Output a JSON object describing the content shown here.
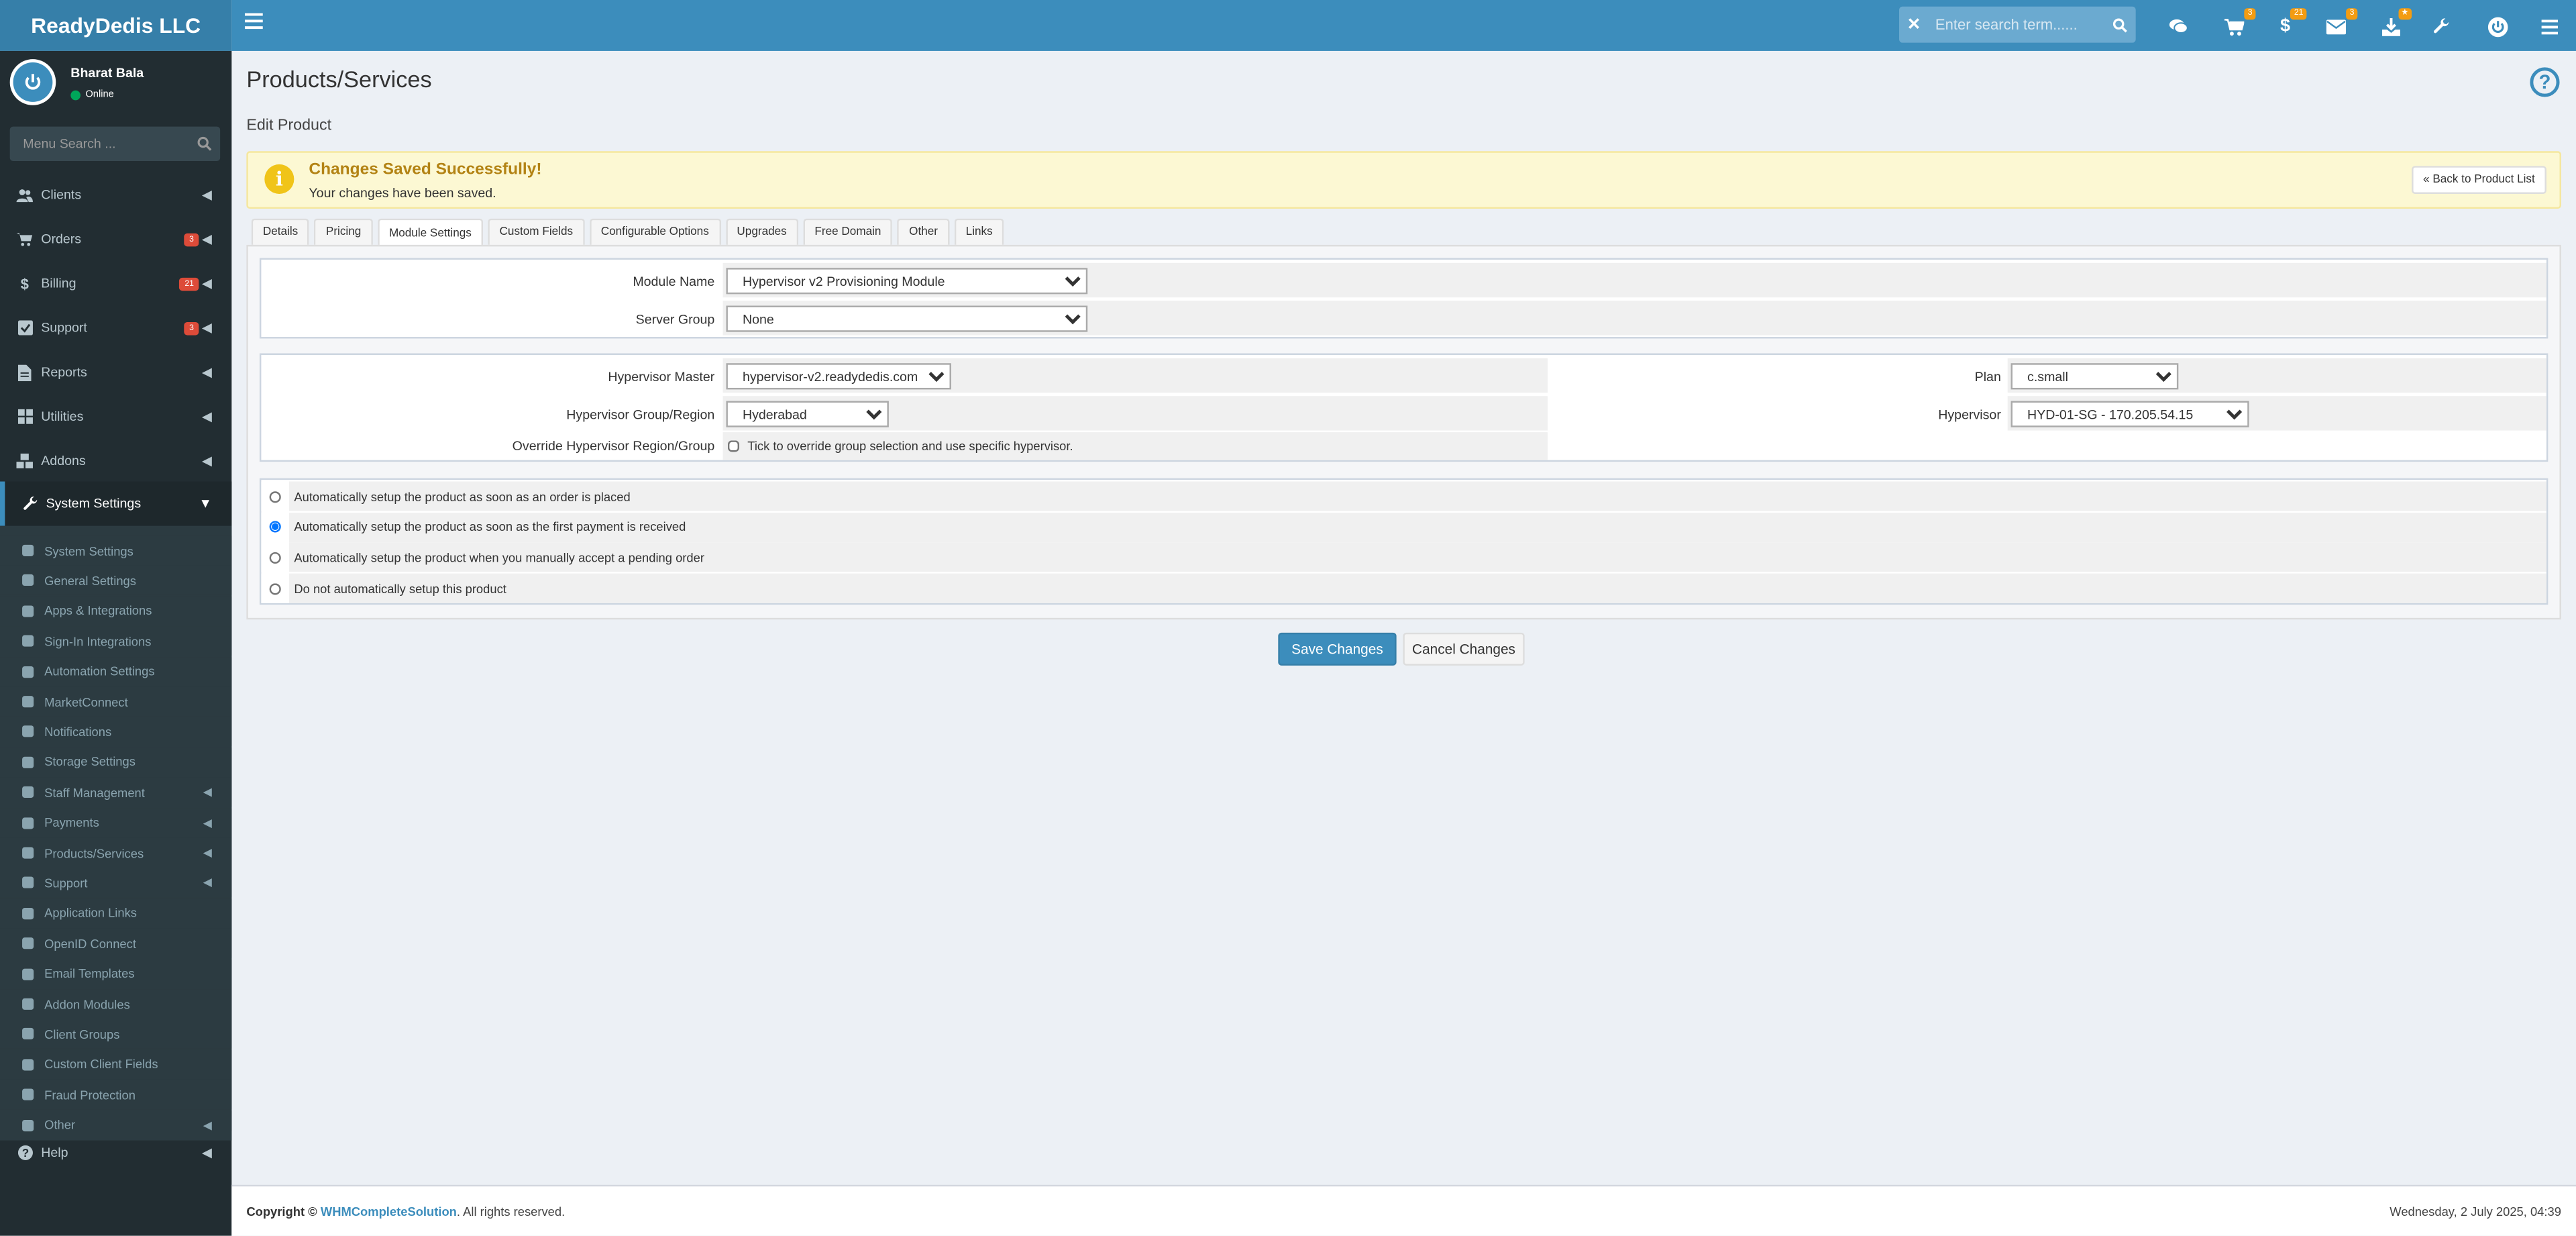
{
  "brand": "ReadyDedis LLC",
  "topbar": {
    "search_placeholder": "Enter search term......",
    "badges": {
      "cart": "3",
      "billing": "21",
      "email": "3",
      "updates": "★"
    }
  },
  "user": {
    "name": "Bharat Bala",
    "status": "Online"
  },
  "menu_search_placeholder": "Menu Search ...",
  "nav": [
    {
      "label": "Clients",
      "icon": "users-icon"
    },
    {
      "label": "Orders",
      "icon": "cart-icon",
      "badge": "3"
    },
    {
      "label": "Billing",
      "icon": "dollar-icon",
      "badge": "21"
    },
    {
      "label": "Support",
      "icon": "ticket-icon",
      "badge": "3"
    },
    {
      "label": "Reports",
      "icon": "file-icon"
    },
    {
      "label": "Utilities",
      "icon": "grid-icon"
    },
    {
      "label": "Addons",
      "icon": "cubes-icon"
    },
    {
      "label": "System Settings",
      "icon": "wrench-icon"
    }
  ],
  "subnav": [
    {
      "label": "System Settings",
      "icon": "gear-icon"
    },
    {
      "label": "General Settings",
      "icon": "wrench-icon"
    },
    {
      "label": "Apps & Integrations",
      "icon": "cubes-icon"
    },
    {
      "label": "Sign-In Integrations",
      "icon": "signin-icon"
    },
    {
      "label": "Automation Settings",
      "icon": "gears-icon"
    },
    {
      "label": "MarketConnect",
      "icon": "bag-icon"
    },
    {
      "label": "Notifications",
      "icon": "bell-icon"
    },
    {
      "label": "Storage Settings",
      "icon": "cloud-icon"
    },
    {
      "label": "Staff Management",
      "icon": "user-icon",
      "chevron": true
    },
    {
      "label": "Payments",
      "icon": "dollar-icon",
      "chevron": true
    },
    {
      "label": "Products/Services",
      "icon": "list-icon",
      "chevron": true
    },
    {
      "label": "Support",
      "icon": "support-icon",
      "chevron": true
    },
    {
      "label": "Application Links",
      "icon": "share-icon"
    },
    {
      "label": "OpenID Connect",
      "icon": "openid-icon"
    },
    {
      "label": "Email Templates",
      "icon": "envelope-icon"
    },
    {
      "label": "Addon Modules",
      "icon": "cubes-icon"
    },
    {
      "label": "Client Groups",
      "icon": "users-icon"
    },
    {
      "label": "Custom Client Fields",
      "icon": "list-icon"
    },
    {
      "label": "Fraud Protection",
      "icon": "shield-icon"
    },
    {
      "label": "Other",
      "icon": "wrench-icon",
      "chevron": true
    }
  ],
  "help_label": "Help",
  "page": {
    "title": "Products/Services",
    "subtitle": "Edit Product",
    "alert_title": "Changes Saved Successfully!",
    "alert_msg": "Your changes have been saved.",
    "back_label": "« Back to Product List",
    "tabs": [
      "Details",
      "Pricing",
      "Module Settings",
      "Custom Fields",
      "Configurable Options",
      "Upgrades",
      "Free Domain",
      "Other",
      "Links"
    ],
    "active_tab": "Module Settings"
  },
  "module": {
    "module_name_label": "Module Name",
    "module_name_value": "Hypervisor v2 Provisioning Module",
    "server_group_label": "Server Group",
    "server_group_value": "None"
  },
  "config": {
    "master_label": "Hypervisor Master",
    "master_value": "hypervisor-v2.readydedis.com",
    "group_label": "Hypervisor Group/Region",
    "group_value": "Hyderabad",
    "override_label": "Override Hypervisor Region/Group",
    "override_text": "Tick to override group selection and use specific hypervisor.",
    "plan_label": "Plan",
    "plan_value": "c.small",
    "hypervisor_label": "Hypervisor",
    "hypervisor_value": "HYD-01-SG - 170.205.54.15"
  },
  "setup_options": [
    {
      "label": "Automatically setup the product as soon as an order is placed",
      "checked": false
    },
    {
      "label": "Automatically setup the product as soon as the first payment is received",
      "checked": true
    },
    {
      "label": "Automatically setup the product when you manually accept a pending order",
      "checked": false
    },
    {
      "label": "Do not automatically setup this product",
      "checked": false
    }
  ],
  "buttons": {
    "save": "Save Changes",
    "cancel": "Cancel Changes"
  },
  "footer": {
    "copyright": "Copyright ©",
    "link": "WHMCompleteSolution",
    "rights": ". All rights reserved.",
    "datetime": "Wednesday, 2 July 2025, 04:39"
  }
}
